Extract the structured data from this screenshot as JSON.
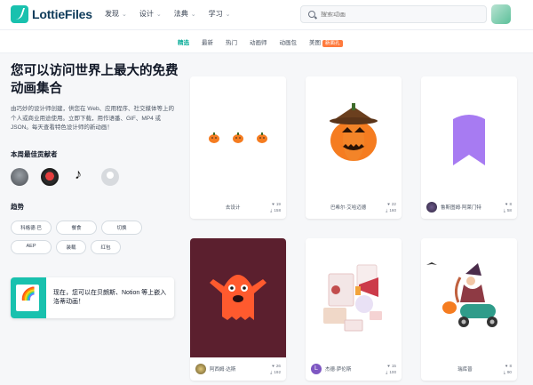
{
  "header": {
    "logo_text": "LottieFiles",
    "nav": [
      "发现",
      "设计",
      "法典",
      "学习"
    ],
    "search_placeholder": "搜索动画"
  },
  "tabs": {
    "items": [
      "精选",
      "最新",
      "热门",
      "动画师",
      "动画包",
      "美图"
    ],
    "new_badge": "新面孔"
  },
  "hero": {
    "title": "您可以访问世界上最大的免费动画集合",
    "desc": "由巧妙的设计师创建，供您在 Web、应用程序、社交媒体等上的个人或商业用途使用。立即下载，用作语番、GIF、MP4 或 JSON。每天查看特色设计师的新动画！"
  },
  "contributors": {
    "heading": "本周最佳贡献者"
  },
  "trends": {
    "heading": "趋势",
    "chips": [
      "科格德·巴",
      "餐食",
      "切换",
      "AEP",
      "装载",
      "红包"
    ]
  },
  "promo": {
    "text": "现在，您可以在贝朗斯、Notion 等上嵌入洛蒂动画！"
  },
  "cards": [
    {
      "author": "去设计",
      "likes": "19",
      "downloads": "158"
    },
    {
      "author": "巴希尔·艾哈迈德",
      "likes": "22",
      "downloads": "160"
    },
    {
      "author": "鲁斯图姆·阿莱门特",
      "likes": "8",
      "downloads": "58"
    },
    {
      "author": "阿西姆·达斯",
      "likes": "26",
      "downloads": "192"
    },
    {
      "author": "杰德·萨伦斯",
      "likes": "15",
      "downloads": "100"
    },
    {
      "author": "瑞库普",
      "likes": "8",
      "downloads": "90"
    }
  ],
  "colors": {
    "brand": "#19c1ae",
    "active_tab": "#0fae9b",
    "new_badge": "#ff7a3d",
    "pumpkin": "#f57c20",
    "bookmark": "#a77bf2",
    "monster": "#ff5a2e",
    "monster_bg": "#5b1f2e"
  }
}
